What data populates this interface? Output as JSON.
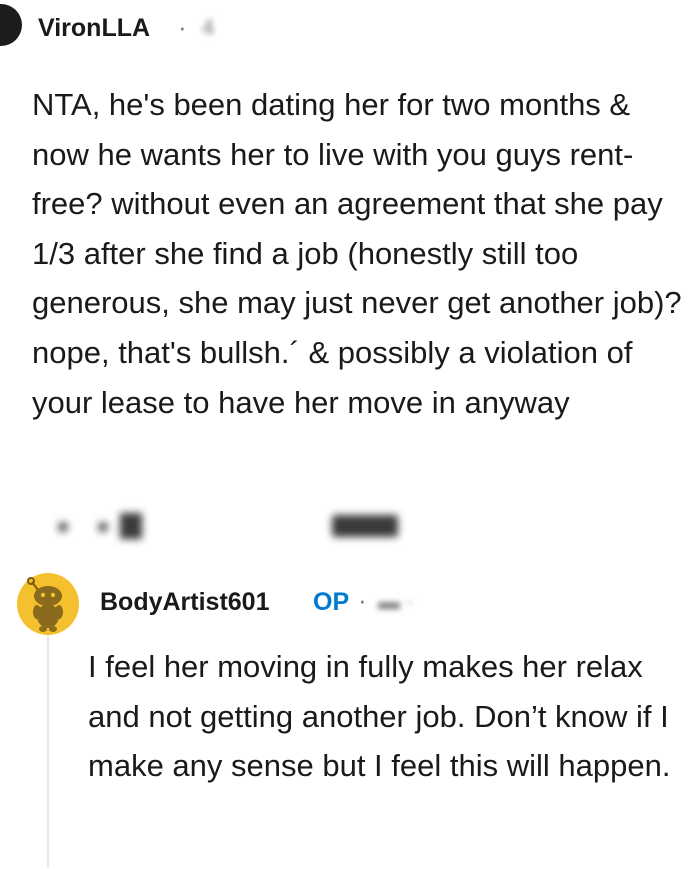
{
  "comment": {
    "username": "VironLLA",
    "separator": "·",
    "age": "4",
    "text": "NTA, he's been dating her for two months & now he wants her to live with you guys rent-free? without even an agreement that she pay 1/3 after she find a job (honestly still too generous, she may just never get another job)? nope, that's bullsh.´ & possibly a violation of your lease to have her move in anyway"
  },
  "reply": {
    "username": "BodyArtist601",
    "badge": "OP",
    "separator": "·",
    "text": "I feel her moving in fully makes her relax and not getting another job. Don’t know if I make any sense but I feel this will happen."
  },
  "colors": {
    "text": "#1a1a1b",
    "meta": "#7c7c7c",
    "op_badge": "#0079d3",
    "avatar_gold": "#f5c02e",
    "thread_line": "#e8e8e8"
  },
  "icons": {
    "reply_avatar": "snoo-avatar-icon"
  }
}
